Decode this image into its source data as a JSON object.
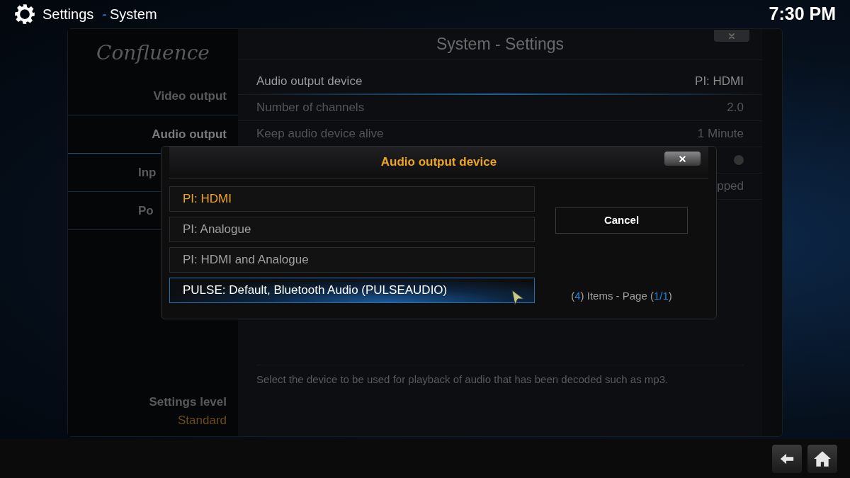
{
  "header": {
    "title": "Settings",
    "separator": "-",
    "subtitle": "System",
    "clock": "7:30 PM"
  },
  "sidebar": {
    "logo": "Confluence",
    "items": [
      {
        "label": "Video output",
        "selected": false,
        "cut": false
      },
      {
        "label": "Audio output",
        "selected": true,
        "cut": false
      },
      {
        "label": "Inp",
        "selected": false,
        "cut": true
      },
      {
        "label": "Po",
        "selected": false,
        "cut": true
      }
    ],
    "settings_level": {
      "label": "Settings level",
      "value": "Standard"
    }
  },
  "panel": {
    "title": "System - Settings",
    "settings": [
      {
        "kind": "value",
        "label": "Audio output device",
        "value": "PI: HDMI",
        "focused": true
      },
      {
        "kind": "value",
        "label": "Number of channels",
        "value": "2.0",
        "focused": false
      },
      {
        "kind": "value",
        "label": "Keep audio device alive",
        "value": "1 Minute",
        "focused": false
      },
      {
        "kind": "toggle",
        "on": false,
        "focused": false
      },
      {
        "kind": "value",
        "value": "pped",
        "focused": false
      }
    ],
    "description": "Select the device to be used for playback of audio that has been decoded such as mp3."
  },
  "dialog": {
    "title": "Audio output device",
    "options": [
      {
        "label": "PI: HDMI",
        "selected": true,
        "focused": false
      },
      {
        "label": "PI: Analogue",
        "selected": false,
        "focused": false
      },
      {
        "label": "PI: HDMI and Analogue",
        "selected": false,
        "focused": false
      },
      {
        "label": "PULSE: Default, Bluetooth Audio (PULSEAUDIO)",
        "selected": false,
        "focused": true
      }
    ],
    "cancel": "Cancel",
    "page_info": [
      {
        "kind": "plain",
        "text": "("
      },
      {
        "kind": "number",
        "text": "4"
      },
      {
        "kind": "plain",
        "text": ") Items - Page ("
      },
      {
        "kind": "number",
        "text": "1/1"
      },
      {
        "kind": "plain",
        "text": ")"
      }
    ]
  }
}
